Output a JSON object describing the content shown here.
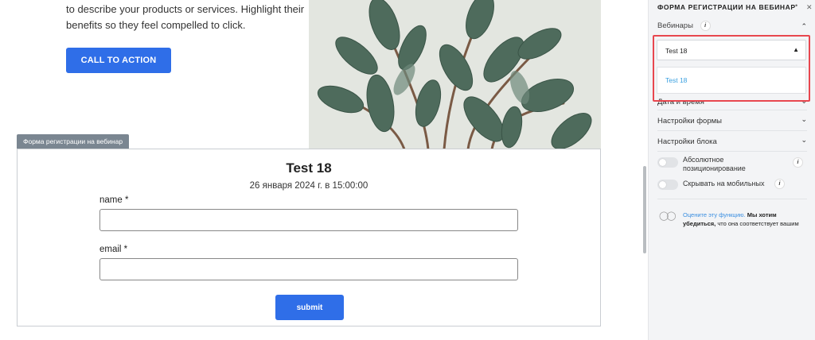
{
  "hero": {
    "text_line1": "to describe your products or services. Highlight their",
    "text_line2": "benefits so they feel compelled to click.",
    "cta_label": "CALL TO ACTION"
  },
  "form_block": {
    "tag_label": "Форма регистрации на вебинар",
    "webinar_title": "Test 18",
    "webinar_date": "26 января 2024 г. в 15:00:00",
    "fields": [
      {
        "label": "name *",
        "value": ""
      },
      {
        "label": "email *",
        "value": ""
      }
    ],
    "submit_label": "submit"
  },
  "panel": {
    "title": "ФОРМА РЕГИСТРАЦИИ НА ВЕБИНАР",
    "webinars_label": "Вебинары",
    "selected_webinar": "Test 18",
    "dropdown_options": [
      "Test 18"
    ],
    "sections": [
      "Дата и время",
      "Настройки формы",
      "Настройки блока"
    ],
    "toggles": [
      {
        "label_line1": "Абсолютное",
        "label_line2": "позиционирование",
        "on": false
      },
      {
        "label_line1": "Скрывать на мобильных",
        "label_line2": "",
        "on": false
      }
    ],
    "rate_link": "Оцените эту функцию.",
    "rate_text1": " Мы хотим",
    "rate_bold": "убедиться,",
    "rate_text2": " что она соответствует вашим",
    "highlight_color": "#e8474f",
    "accent_color": "#2f6ee8"
  }
}
